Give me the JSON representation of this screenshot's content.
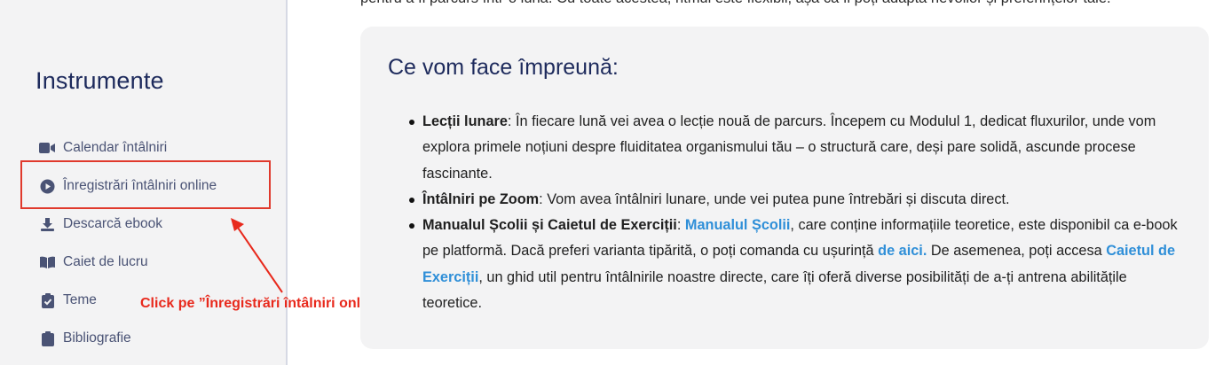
{
  "sidebar": {
    "title": "Instrumente",
    "items": [
      {
        "label": "Calendar întâlniri",
        "icon": "video-camera-icon"
      },
      {
        "label": "Înregistrări întâlniri online",
        "icon": "play-circle-icon"
      },
      {
        "label": "Descarcă ebook",
        "icon": "download-icon"
      },
      {
        "label": "Caiet de lucru",
        "icon": "open-book-icon"
      },
      {
        "label": "Teme",
        "icon": "clipboard-check-icon"
      },
      {
        "label": "Bibliografie",
        "icon": "clipboard-icon"
      }
    ]
  },
  "annotation": {
    "text": "Click pe ”Înregistrări întâlniri online”",
    "color": "#e8291c"
  },
  "main": {
    "top_text": "pentru a fi parcurs într-o lună. Cu toate acestea, ritmul este flexibil, așa că îl poți adapta nevoilor și preferințelor tale.",
    "card": {
      "title": "Ce vom face împreună:",
      "items": [
        {
          "bold": "Lecții lunare",
          "text": ": În fiecare lună vei avea o lecție nouă de parcurs. Începem cu Modulul 1, dedicat fluxurilor, unde vom explora primele noțiuni despre fluiditatea organismului tău – o structură care, deși pare solidă, ascunde procese fascinante."
        },
        {
          "bold": "Întâlniri pe Zoom",
          "text": ": Vom avea întâlniri lunare, unde vei putea pune întrebări și discuta direct."
        },
        {
          "bold": "Manualul Școlii și Caietul de Exerciții",
          "sep": ": ",
          "link1": "Manualul Școlii",
          "text1": ", care conține informațiile teoretice, este disponibil ca e-book pe platformă. Dacă preferi varianta tipărită, o poți comanda cu ușurință ",
          "link2": "de aici.",
          "text2": " De asemenea, poți accesa ",
          "link3": "Caietul de Exerciții",
          "text3": ", un ghid util pentru întâlnirile noastre directe, care îți oferă diverse posibilități de a-ți antrena abilitățile teoretice."
        }
      ]
    }
  },
  "colors": {
    "sidebar_bg": "#f3f3f4",
    "title": "#1d2a5c",
    "nav_text": "#4a5375",
    "link": "#2f8fd8",
    "highlight": "#e0392c"
  }
}
